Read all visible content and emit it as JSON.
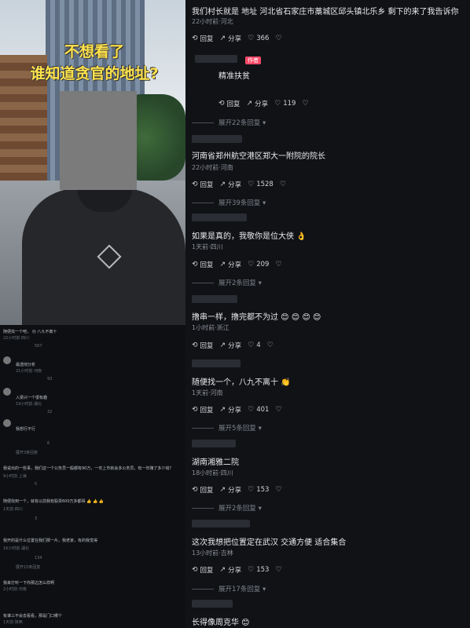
{
  "video": {
    "overlay_title_line1": "不想看了",
    "overlay_title_line2": "谁知道贪官的地址?"
  },
  "mini_comments": [
    {
      "text": "随便找一个吧，  😐  八九不离十",
      "meta": "22小时前·四川",
      "likes": "567"
    },
    {
      "text": "最透彻分析",
      "meta": "21小时前·河南",
      "likes": "93"
    },
    {
      "text": "入梁兴一个很有趣",
      "meta": "19小时前·湖北",
      "likes": "32"
    },
    {
      "text": "我想行不行",
      "meta": "1天前·河南",
      "likes": "6"
    },
    {
      "text": "展开3条回复",
      "meta": "",
      "likes": ""
    },
    {
      "text": "我说出的一些事，我们这一个公务员一般都有90万，一年上市就会多公务员，有一年赚了多少钱?",
      "meta": "9小时前·上海",
      "likes": "5"
    },
    {
      "text": "随便找到一个，就有以前我有股票600万多都得 👍 👍 👍",
      "meta": "1天前·四川",
      "likes": "3"
    },
    {
      "text": "我开的是什么位置在我们那一片，我老家，有的我觉得",
      "meta": "16小时前·湖北",
      "likes": "134"
    },
    {
      "text": "展开15条回复",
      "meta": "",
      "likes": ""
    },
    {
      "text": "我来打听一下你那边怎么样啊",
      "meta": "2小时前·河南",
      "likes": ""
    },
    {
      "text": "有谁三不会去看看，那是门口哪个",
      "meta": "1天前·陕西",
      "likes": ""
    }
  ],
  "actions": {
    "reply": "回复",
    "share": "分享"
  },
  "author_badge": "作者",
  "comments": [
    {
      "text": "我们村长就是 地址 河北省石家庄市藁城区邱头镇北乐乡 剩下的来了我告诉你",
      "meta": "22小时前·河北",
      "likes": "366"
    },
    {
      "text": "精准扶贫",
      "meta": "",
      "likes": "119",
      "is_author_reply": true
    },
    {
      "text": "河南省郑州航空港区郑大一附院的院长",
      "meta": "22小时前·河南",
      "likes": "1528"
    },
    {
      "text": "如果是真的，我敬你是位大侠 👌",
      "meta": "1天前·四川",
      "likes": "209"
    },
    {
      "text": "撸串一样，撸完都不为过 😊 😊 😊 😊",
      "meta": "1小时前·浙江",
      "likes": "4"
    },
    {
      "text": "随便找一个，八九不离十 👏",
      "meta": "1天前·河南",
      "likes": "401"
    },
    {
      "text": "湖南湘雅二院",
      "meta": "18小时前·四川",
      "likes": "153"
    },
    {
      "text": "这次我想把位置定在武汉 交通方便 适合集合",
      "meta": "13小时前·吉林",
      "likes": "153"
    },
    {
      "text": "长得像周克华 😊",
      "meta": "",
      "likes": ""
    }
  ],
  "expands": [
    "展开22条回复",
    "展开39条回复",
    "展开2条回复",
    "展开5条回复",
    "展开2条回复",
    "展开17条回复"
  ]
}
